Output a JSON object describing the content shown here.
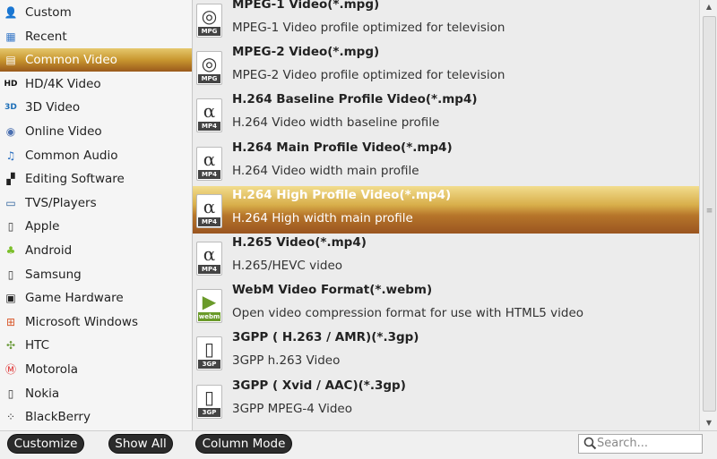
{
  "sidebar": {
    "items": [
      {
        "label": "Custom",
        "icon": "user-icon"
      },
      {
        "label": "Recent",
        "icon": "recent-icon"
      },
      {
        "label": "Common Video",
        "icon": "film-icon",
        "selected": true
      },
      {
        "label": "HD/4K Video",
        "icon": "hd-icon"
      },
      {
        "label": "3D Video",
        "icon": "3d-icon"
      },
      {
        "label": "Online Video",
        "icon": "online-video-icon"
      },
      {
        "label": "Common Audio",
        "icon": "music-note-icon"
      },
      {
        "label": "Editing Software",
        "icon": "clapperboard-icon"
      },
      {
        "label": "TVS/Players",
        "icon": "tv-icon"
      },
      {
        "label": "Apple",
        "icon": "phone-icon"
      },
      {
        "label": "Android",
        "icon": "android-icon"
      },
      {
        "label": "Samsung",
        "icon": "phone-icon"
      },
      {
        "label": "Game Hardware",
        "icon": "game-console-icon"
      },
      {
        "label": "Microsoft Windows",
        "icon": "windows-icon"
      },
      {
        "label": "HTC",
        "icon": "htc-icon"
      },
      {
        "label": "Motorola",
        "icon": "motorola-icon"
      },
      {
        "label": "Nokia",
        "icon": "phone-icon"
      },
      {
        "label": "BlackBerry",
        "icon": "blackberry-icon"
      }
    ]
  },
  "formats": [
    {
      "title": "MPEG-1 Video(*.mpg)",
      "desc": "MPEG-1 Video profile optimized for television",
      "icon": "mpg-file-icon",
      "icon_tag": "MPG"
    },
    {
      "title": "MPEG-2 Video(*.mpg)",
      "desc": "MPEG-2 Video profile optimized for television",
      "icon": "mpg-file-icon",
      "icon_tag": "MPG"
    },
    {
      "title": "H.264 Baseline Profile Video(*.mp4)",
      "desc": "H.264 Video width baseline profile",
      "icon": "mp4-file-icon",
      "icon_tag": "MP4"
    },
    {
      "title": "H.264 Main Profile Video(*.mp4)",
      "desc": "H.264 Video width main profile",
      "icon": "mp4-file-icon",
      "icon_tag": "MP4"
    },
    {
      "title": "H.264 High Profile Video(*.mp4)",
      "desc": "H.264 High width main profile",
      "icon": "mp4-file-icon",
      "icon_tag": "MP4",
      "selected": true
    },
    {
      "title": "H.265 Video(*.mp4)",
      "desc": "H.265/HEVC video",
      "icon": "mp4-file-icon",
      "icon_tag": "MP4"
    },
    {
      "title": "WebM Video Format(*.webm)",
      "desc": "Open video compression format for use with HTML5 video",
      "icon": "webm-file-icon",
      "icon_tag": "webm"
    },
    {
      "title": "3GPP ( H.263 / AMR)(*.3gp)",
      "desc": "3GPP h.263 Video",
      "icon": "3gp-file-icon",
      "icon_tag": "3GP"
    },
    {
      "title": "3GPP ( Xvid / AAC)(*.3gp)",
      "desc": "3GPP MPEG-4 Video",
      "icon": "3gp-file-icon",
      "icon_tag": "3GP"
    }
  ],
  "toolbar": {
    "customize_label": "Customize",
    "show_all_label": "Show All",
    "column_mode_label": "Column Mode"
  },
  "search": {
    "placeholder": "Search..."
  },
  "colors": {
    "selection_top": "#f2dd8e",
    "selection_bottom": "#9a5520",
    "button_bg": "#2b2b2b"
  }
}
